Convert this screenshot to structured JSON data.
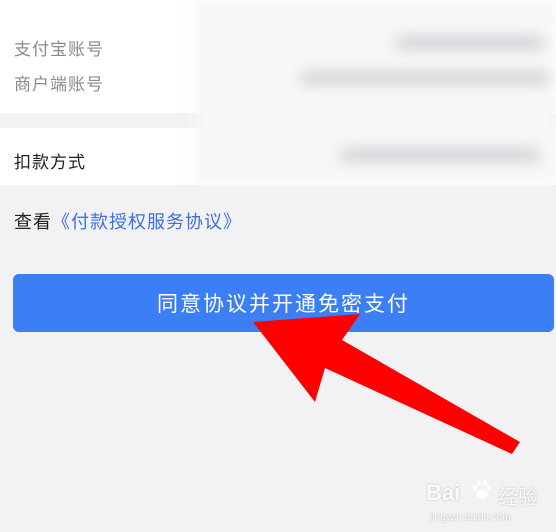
{
  "account_info": {
    "alipay_account_label": "支付宝账号",
    "merchant_account_label": "商户端账号"
  },
  "payment_method": {
    "label": "扣款方式"
  },
  "agreement": {
    "prefix": "查看",
    "link_text": "《付款授权服务协议》"
  },
  "primary_action": {
    "label": "同意协议并开通免密支付"
  },
  "annotation": {
    "arrow_color": "#ff0000",
    "arrow_icon": "red-arrow-pointing-to-button"
  },
  "watermark": {
    "brand": "Bai",
    "brand_suffix": "经验",
    "paw_icon": "baidu-paw-icon",
    "url": "jingyan.baidu.com"
  },
  "colors": {
    "button_blue": "#3c7ff5",
    "link_blue": "#3b6fe0",
    "background": "#f2f2f5"
  }
}
